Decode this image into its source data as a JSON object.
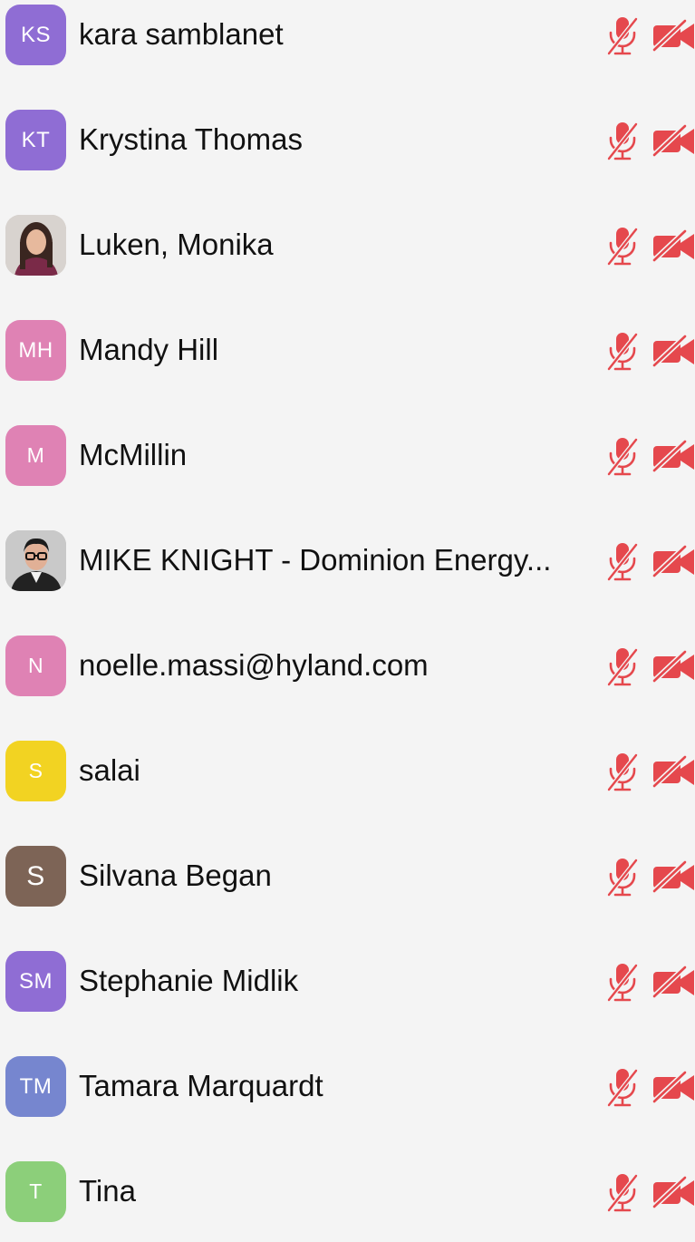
{
  "colors": {
    "background": "#f4f4f4",
    "muted_red": "#e5484d",
    "avatar_purple": "#8f6dd4",
    "avatar_pink": "#df82b4",
    "avatar_yellow": "#f2d322",
    "avatar_brown": "#7d6456",
    "avatar_blue": "#7686cf",
    "avatar_green": "#8ccf7a"
  },
  "participants": [
    {
      "initials": "KS",
      "name": "kara samblanet",
      "avatar_type": "initials",
      "avatar_color": "#8f6dd4",
      "mic": "muted",
      "video": "off"
    },
    {
      "initials": "KT",
      "name": "Krystina Thomas",
      "avatar_type": "initials",
      "avatar_color": "#8f6dd4",
      "mic": "muted",
      "video": "off"
    },
    {
      "initials": "",
      "name": "Luken, Monika",
      "avatar_type": "photo",
      "avatar_color": "#c9c2bb",
      "mic": "muted",
      "video": "off"
    },
    {
      "initials": "MH",
      "name": "Mandy Hill",
      "avatar_type": "initials",
      "avatar_color": "#df82b4",
      "mic": "muted",
      "video": "off"
    },
    {
      "initials": "M",
      "name": "McMillin",
      "avatar_type": "initials",
      "avatar_color": "#df82b4",
      "mic": "muted",
      "video": "off"
    },
    {
      "initials": "",
      "name": "MIKE KNIGHT - Dominion Energy...",
      "avatar_type": "photo",
      "avatar_color": "#b9b9b9",
      "mic": "muted",
      "video": "off"
    },
    {
      "initials": "N",
      "name": "noelle.massi@hyland.com",
      "avatar_type": "initials",
      "avatar_color": "#df82b4",
      "mic": "muted",
      "video": "off"
    },
    {
      "initials": "S",
      "name": "salai",
      "avatar_type": "initials",
      "avatar_color": "#f2d322",
      "mic": "muted",
      "video": "off"
    },
    {
      "initials": "S",
      "name": "Silvana Began",
      "avatar_type": "initials",
      "avatar_color": "#7d6456",
      "mic": "muted",
      "video": "off"
    },
    {
      "initials": "SM",
      "name": "Stephanie Midlik",
      "avatar_type": "initials",
      "avatar_color": "#8f6dd4",
      "mic": "muted",
      "video": "off"
    },
    {
      "initials": "TM",
      "name": "Tamara Marquardt",
      "avatar_type": "initials",
      "avatar_color": "#7686cf",
      "mic": "muted",
      "video": "off"
    },
    {
      "initials": "T",
      "name": "Tina",
      "avatar_type": "initials",
      "avatar_color": "#8ccf7a",
      "mic": "muted",
      "video": "off"
    }
  ],
  "icons": {
    "mic": "mic-muted-icon",
    "camera": "video-off-icon"
  }
}
